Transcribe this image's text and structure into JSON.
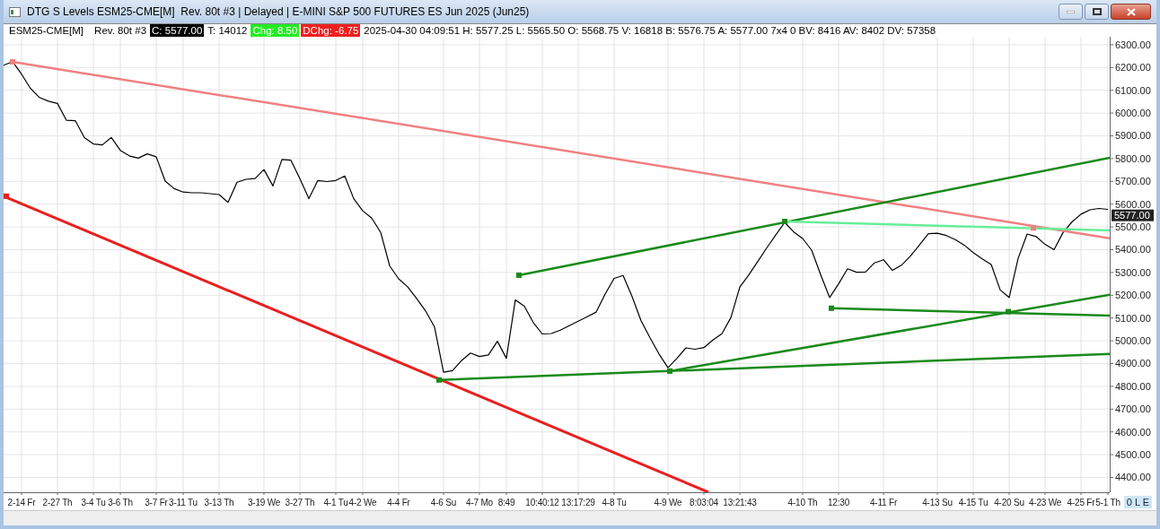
{
  "window": {
    "title": "DTG S Levels ESM25-CME[M]  Rev. 80t #3 | Delayed | E-MINI S&P 500 FUTURES ES Jun 2025 (Jun25)"
  },
  "info_bar": [
    {
      "kind": "plain",
      "text": "ESM25-CME[M]"
    },
    {
      "kind": "plain",
      "text": "Rev. 80t #3"
    },
    {
      "kind": "close",
      "text": "C: 5577.00"
    },
    {
      "kind": "plain",
      "text": "T: 14012"
    },
    {
      "kind": "up",
      "text": "Chg: 8.50"
    },
    {
      "kind": "down",
      "text": "DChg: -6.75"
    },
    {
      "kind": "plain",
      "text": "2025-04-30 04:09:51 H: 5577.25 L: 5565.50 O: 5568.75 V: 16818 B: 5576.75 A: 5577.00 7x4 0 BV: 8416 AV: 8402 DV: 57358"
    }
  ],
  "chart": {
    "chart_data": {
      "type": "line",
      "categories": [
        null,
        null,
        "2-14 Fr",
        null,
        null,
        null,
        "2-27 Th",
        null,
        null,
        null,
        "3-4 Tu",
        null,
        null,
        "3-6 Th",
        null,
        null,
        null,
        "3-7 Fr",
        null,
        null,
        "3-11 Tu",
        null,
        null,
        null,
        "3-13 Th",
        null,
        null,
        null,
        null,
        "3-19 We",
        null,
        null,
        null,
        "3-27 Th",
        null,
        null,
        null,
        "4-1 Tu",
        null,
        null,
        "4-2 We",
        null,
        null,
        null,
        "4-4 Fr",
        null,
        null,
        null,
        null,
        "4-6 Su",
        null,
        null,
        null,
        "4-7 Mo",
        null,
        null,
        "8:49",
        null,
        null,
        null,
        "10:40:12",
        null,
        null,
        null,
        "13:17:29",
        null,
        null,
        null,
        "4-8 Tu",
        null,
        null,
        null,
        null,
        null,
        "4-9 We",
        null,
        null,
        null,
        "8:03:04",
        null,
        null,
        null,
        "13:21:43",
        null,
        null,
        null,
        null,
        null,
        null,
        "4-10 Th",
        null,
        null,
        null,
        "12:30",
        null,
        null,
        null,
        null,
        "4-11 Fr",
        null,
        null,
        null,
        null,
        null,
        "4-13 Su",
        null,
        null,
        null,
        "4-15 Tu",
        null,
        null,
        null,
        "4-20 Su",
        null,
        null,
        null,
        "4-23 We",
        null,
        null,
        null,
        "4-25 Fr",
        null,
        null,
        "5-1 Th"
      ],
      "grid": true,
      "series": [
        {
          "color": "#000000",
          "values": [
            6210,
            6226,
            6171,
            6108,
            6068,
            6052,
            6042,
            5968,
            5966,
            5892,
            5864,
            5860,
            5893,
            5836,
            5812,
            5802,
            5821,
            5808,
            5701,
            5668,
            5653,
            5650,
            5650,
            5646,
            5642,
            5608,
            5696,
            5709,
            5712,
            5752,
            5680,
            5796,
            5793,
            5712,
            5624,
            5704,
            5699,
            5704,
            5724,
            5624,
            5571,
            5539,
            5476,
            5329,
            5272,
            5237,
            5186,
            5131,
            5060,
            4862,
            4869,
            4913,
            4946,
            4931,
            4938,
            4998,
            4923,
            5180,
            5152,
            5080,
            5030,
            5032,
            5047,
            5066,
            5086,
            5106,
            5126,
            5205,
            5274,
            5287,
            5194,
            5088,
            5013,
            4942,
            4882,
            4923,
            4969,
            4963,
            4970,
            5003,
            5031,
            5101,
            5236,
            5289,
            5348,
            5408,
            5464,
            5520,
            5478,
            5449,
            5398,
            5291,
            5190,
            5250,
            5316,
            5301,
            5302,
            5342,
            5356,
            5309,
            5332,
            5372,
            5420,
            5470,
            5472,
            5462,
            5444,
            5420,
            5387,
            5360,
            5335,
            5223,
            5190,
            5362,
            5469,
            5458,
            5423,
            5400,
            5475,
            5522,
            5556,
            5575,
            5581,
            5577
          ]
        }
      ],
      "ylim": [
        4335,
        6335
      ],
      "yticks": [
        {
          "value": 6300,
          "label": "6300.00"
        },
        {
          "value": 6200,
          "label": "6200.00"
        },
        {
          "value": 6100,
          "label": "6100.00"
        },
        {
          "value": 6000,
          "label": "6000.00"
        },
        {
          "value": 5900,
          "label": "5900.00"
        },
        {
          "value": 5800,
          "label": "5800.00"
        },
        {
          "value": 5700,
          "label": "5700.00"
        },
        {
          "value": 5600,
          "label": "5600.00"
        },
        {
          "value": 5500,
          "label": "5500.00"
        },
        {
          "value": 5400,
          "label": "5400.00"
        },
        {
          "value": 5300,
          "label": "5300.00"
        },
        {
          "value": 5200,
          "label": "5200.00"
        },
        {
          "value": 5100,
          "label": "5100.00"
        },
        {
          "value": 5000,
          "label": "5000.00"
        },
        {
          "value": 4900,
          "label": "4900.00"
        },
        {
          "value": 4800,
          "label": "4800.00"
        },
        {
          "value": 4700,
          "label": "4700.00"
        },
        {
          "value": 4600,
          "label": "4600.00"
        },
        {
          "value": 4500,
          "label": "4500.00"
        },
        {
          "value": 4400,
          "label": "4400.00"
        }
      ]
    },
    "last_price": "5577.00",
    "scale_badge": "0 L E"
  }
}
